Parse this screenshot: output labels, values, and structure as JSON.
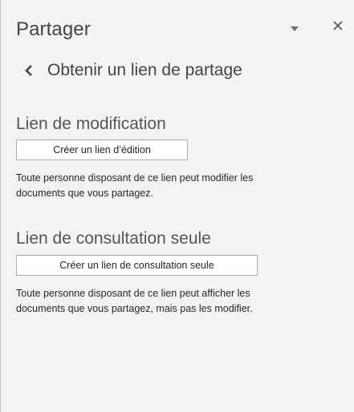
{
  "pane": {
    "title": "Partager",
    "options_icon": "caret-down-icon",
    "close_icon": "close-icon"
  },
  "back": {
    "icon": "chevron-left-icon",
    "label": "Obtenir un lien de partage"
  },
  "edit_link": {
    "heading": "Lien de modification",
    "button_label": "Créer un lien d’édition",
    "description_line1": "Toute personne disposant de ce lien peut modifier les",
    "description_line2": "documents que vous partagez."
  },
  "view_link": {
    "heading": "Lien de consultation seule",
    "button_label": "Créer un lien de consultation seule",
    "description_line1": "Toute personne disposant de ce lien peut afficher les",
    "description_line2": "documents que vous partagez, mais pas les modifier."
  },
  "colors": {
    "pane_background": "#f3f3f3",
    "text": "#262626",
    "heading": "#555555",
    "button_border": "#ababab"
  }
}
